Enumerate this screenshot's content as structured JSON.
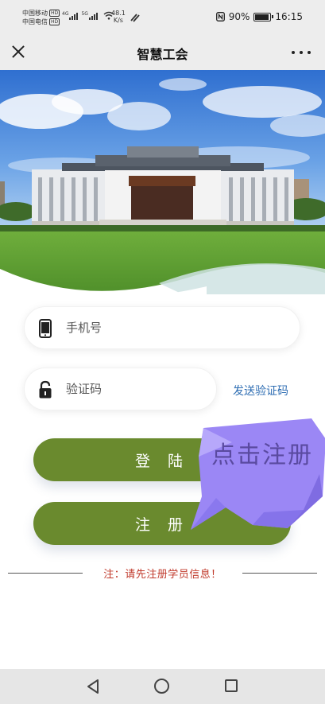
{
  "status_bar": {
    "carrier_1": "中国移动",
    "carrier_2": "中国电信",
    "hd_badge": "HD",
    "network_1": "4G",
    "network_2": "5G",
    "speed_value": "48.1",
    "speed_unit": "K/s",
    "battery": "90%",
    "battery_level": 0.9,
    "time": "16:15"
  },
  "title_bar": {
    "title": "智慧工会"
  },
  "form": {
    "phone_placeholder": "手机号",
    "code_placeholder": "验证码",
    "send_code_label": "发送验证码"
  },
  "buttons": {
    "login_label": "登 陆",
    "register_label": "注 册"
  },
  "badge": {
    "text": "点击注册"
  },
  "notice": "注：请先注册学员信息！",
  "icons": {
    "close": "close-icon",
    "more": "more-icon",
    "phone": "phone-icon",
    "lock": "lock-icon",
    "nfc": "nfc-icon",
    "wifi": "wifi-icon",
    "battery": "battery-icon",
    "nav_back": "back-triangle-icon",
    "nav_home": "home-circle-icon",
    "nav_recent": "recent-square-icon"
  },
  "colors": {
    "button": "#6a8a2e",
    "badge": "#9b87f5",
    "link": "#2f6eb3",
    "notice": "#c0392b"
  }
}
